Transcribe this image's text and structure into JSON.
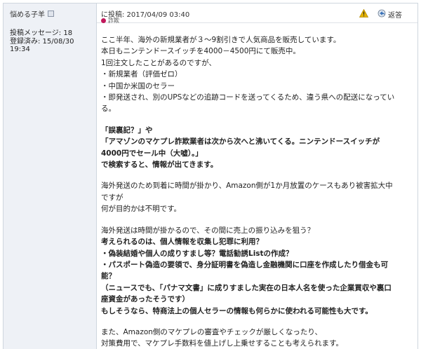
{
  "author": {
    "name": "悩める子羊"
  },
  "meta": {
    "posts_label": "投稿メッセージ: 18",
    "registered_label": "登録済み: 15/08/30",
    "registered_time": "19:34"
  },
  "post": {
    "posted_at": "に投稿: 2017/04/09 03:40",
    "tag": "詐欺",
    "reply_label": "返答"
  },
  "paragraphs": [
    {
      "lines": [
        "ここ半年、海外の新規業者が３～9割引きで人気商品を販売しています。",
        "本日もニンテンドースイッチを4000－4500円にて販売中。",
        "1回注文したことがあるのですが、",
        "・新規業者（評価ゼロ）",
        "・中国か米国のセラー",
        "・即発送され、別のUPSなどの追跡コードを送ってくるため、違う県への配送になってい",
        "る。"
      ]
    },
    {
      "bold": true,
      "lines": [
        "「誤裏記？」や",
        "「アマゾンのマケプレ詐欺業者は次から次へと沸いてくる。ニンテンドースイッチが",
        "4000円でセール中（大嘘）。」",
        "で検索すると、情報が出てきます。"
      ]
    },
    {
      "lines": [
        "海外発送のため到着に時間が掛かり、Amazon側が1か月放置のケースもあり被害拡大中",
        "ですが",
        "何が目的かは不明です。"
      ]
    },
    {
      "lines": [
        "海外発送は時間が掛かるので、その間に売上の振り込みを狙う？"
      ],
      "bold_lines": [
        "考えられるのは、個人情報を収集し犯罪に利用？",
        "・偽装結婚や個人の成りすまし等？電話勧誘Listの作成？",
        "・パスポート偽造の要領で、身分証明書を偽造し金融機関に口座を作成したり借金も可",
        "能？",
        "（ニュースでも、「パナマ文書」に成りすました実在の日本人名を使った企業買収や裏口",
        "座資金があったそうです）",
        "もしそうなら、特商法上の個人セラーの情報も何らかに使われる可能性も大です。"
      ]
    },
    {
      "lines": [
        "また、Amazon側のマケプレの審査やチェックが厳しくなったり、",
        "対策費用で、マケプレ手数料を値上げし上乗せすることも考えられます。"
      ]
    }
  ],
  "icons": {
    "warning": "warning-icon",
    "reply": "reply-icon",
    "tag": "tag-dot-icon",
    "user": "user-badge-icon",
    "color_tag": "#c2185b",
    "color_warning": "#e6b400"
  }
}
